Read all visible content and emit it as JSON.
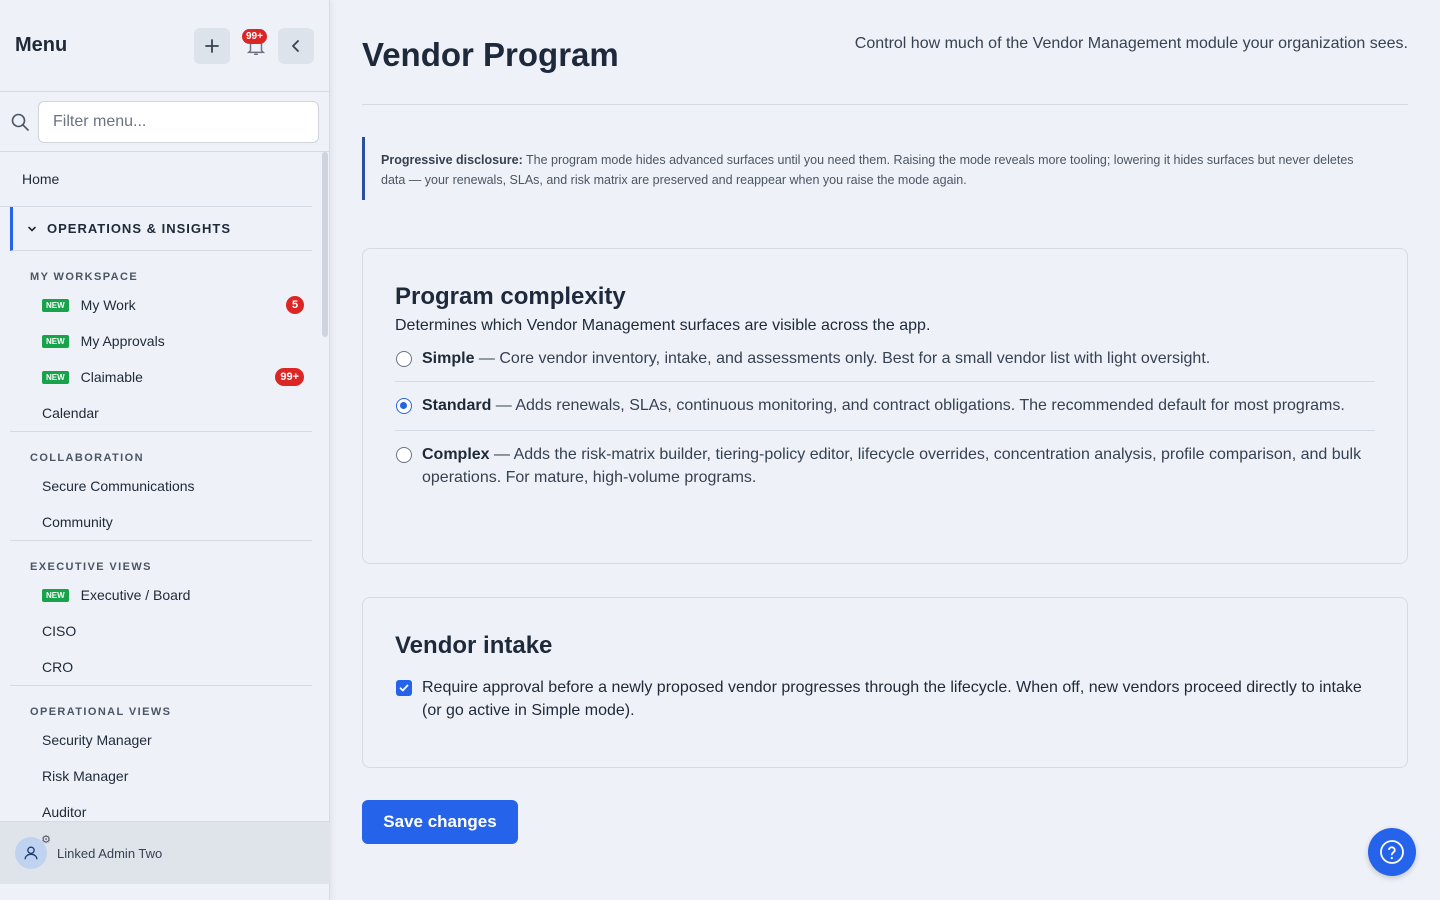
{
  "sidebar": {
    "title": "Menu",
    "notifications_badge": "99+",
    "search_placeholder": "Filter menu...",
    "home_label": "Home",
    "section_label": "OPERATIONS & INSIGHTS",
    "groups": [
      {
        "label": "MY WORKSPACE",
        "items": [
          {
            "label": "My Work",
            "new": "NEW",
            "count": "5"
          },
          {
            "label": "My Approvals",
            "new": "NEW"
          },
          {
            "label": "Claimable",
            "new": "NEW",
            "count": "99+"
          },
          {
            "label": "Calendar"
          }
        ]
      },
      {
        "label": "COLLABORATION",
        "items": [
          {
            "label": "Secure Communications"
          },
          {
            "label": "Community"
          }
        ]
      },
      {
        "label": "EXECUTIVE VIEWS",
        "items": [
          {
            "label": "Executive / Board",
            "new": "NEW"
          },
          {
            "label": "CISO"
          },
          {
            "label": "CRO"
          }
        ]
      },
      {
        "label": "OPERATIONAL VIEWS",
        "items": [
          {
            "label": "Security Manager"
          },
          {
            "label": "Risk Manager"
          },
          {
            "label": "Auditor"
          }
        ]
      }
    ],
    "footer_user": "Linked Admin Two"
  },
  "main": {
    "title": "Vendor Program",
    "subtitle": "Control how much of the Vendor Management module your organization sees.",
    "info_bold": "Progressive disclosure:",
    "info_text": " The program mode hides advanced surfaces until you need them. Raising the mode reveals more tooling; lowering it hides surfaces but never deletes data — your renewals, SLAs, and risk matrix are preserved and reappear when you raise the mode again.",
    "complexity": {
      "title": "Program complexity",
      "description": "Determines which Vendor Management surfaces are visible across the app.",
      "options": [
        {
          "name": "Simple",
          "text": " — Core vendor inventory, intake, and assessments only. Best for a small vendor list with light oversight.",
          "selected": false
        },
        {
          "name": "Standard",
          "text": " — Adds renewals, SLAs, continuous monitoring, and contract obligations. The recommended default for most programs.",
          "selected": true
        },
        {
          "name": "Complex",
          "text": " — Adds the risk-matrix builder, tiering-policy editor, lifecycle overrides, concentration analysis, profile comparison, and bulk operations. For mature, high-volume programs.",
          "selected": false
        }
      ]
    },
    "intake": {
      "title": "Vendor intake",
      "checkbox_label": "Require approval before a newly proposed vendor progresses through the lifecycle. When off, new vendors proceed directly to intake (or go active in Simple mode).",
      "checked": true
    },
    "save_label": "Save changes"
  },
  "colors": {
    "accent": "#2563eb",
    "badge_red": "#dc2626",
    "badge_green": "#16a34a",
    "background": "#eef2f8"
  },
  "icons": [
    "plus-icon",
    "bell-icon",
    "chevron-left-icon",
    "search-icon",
    "chevron-down-icon",
    "user-icon",
    "gear-icon",
    "help-icon"
  ]
}
